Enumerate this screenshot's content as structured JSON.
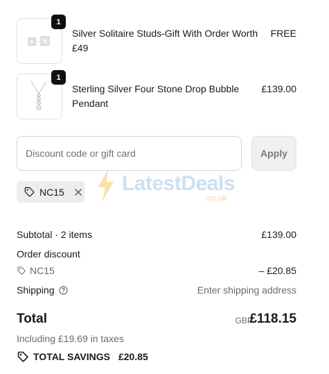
{
  "items": [
    {
      "quantity": "1",
      "name": "Silver Solitaire Studs-Gift With Order Worth £49",
      "price": "FREE",
      "icon": "stud-earrings-image"
    },
    {
      "quantity": "1",
      "name": "Sterling Silver Four Stone Drop Bubble Pendant",
      "price": "£139.00",
      "icon": "pendant-image"
    }
  ],
  "discount": {
    "placeholder": "Discount code or gift card",
    "apply_label": "Apply",
    "applied_code": "NC15"
  },
  "watermark": {
    "text": "LatestDeals",
    "sub": ".co.uk"
  },
  "summary": {
    "subtotal_label": "Subtotal · 2 items",
    "subtotal_value": "£139.00",
    "order_discount_label": "Order discount",
    "discount_code": "NC15",
    "discount_value": "– £20.85",
    "shipping_label": "Shipping",
    "shipping_value": "Enter shipping address",
    "total_label": "Total",
    "currency": "GBP",
    "total_value": "£118.15",
    "taxes_text": "Including £19.69 in taxes",
    "savings_label": "TOTAL SAVINGS",
    "savings_value": "£20.85"
  },
  "colors": {
    "text": "#1a1a1a",
    "muted": "#6b6b6b",
    "chip_bg": "#ededed",
    "badge_bg": "#111111"
  }
}
